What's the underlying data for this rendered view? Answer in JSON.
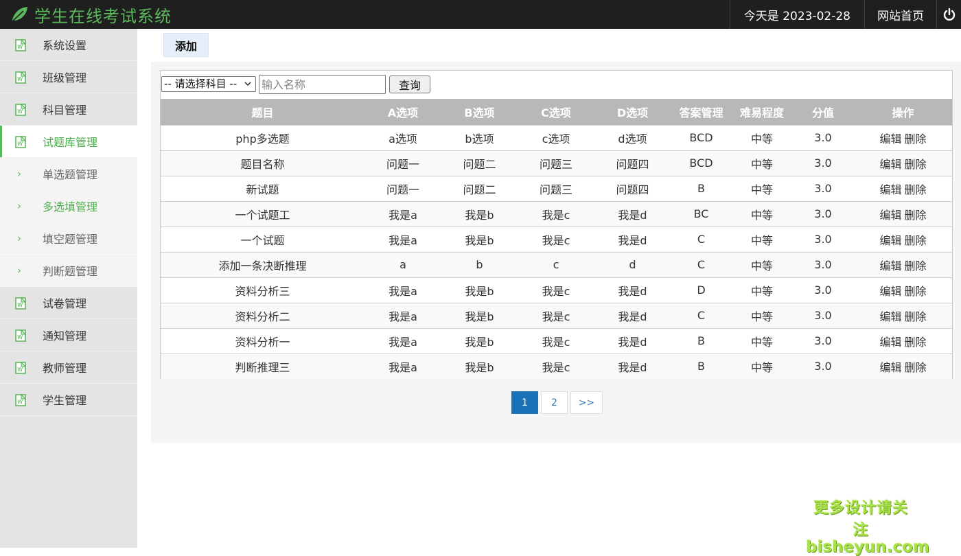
{
  "header": {
    "app_title": "学生在线考试系统",
    "date_text": "今天是 2023-02-28",
    "home_link": "网站首页",
    "brand_color": "#5cb85c"
  },
  "sidebar": {
    "items": [
      {
        "label": "系统设置",
        "icon": "document-icon"
      },
      {
        "label": "班级管理",
        "icon": "document-icon"
      },
      {
        "label": "科目管理",
        "icon": "document-icon"
      },
      {
        "label": "试题库管理",
        "icon": "document-icon",
        "active": true
      },
      {
        "label": "单选题管理",
        "icon": "chevron-right-icon",
        "sub": true
      },
      {
        "label": "多选填管理",
        "icon": "chevron-right-icon",
        "sub": true,
        "current": true
      },
      {
        "label": "填空题管理",
        "icon": "chevron-right-icon",
        "sub": true
      },
      {
        "label": "判断题管理",
        "icon": "chevron-right-icon",
        "sub": true
      },
      {
        "label": "试卷管理",
        "icon": "document-icon"
      },
      {
        "label": "通知管理",
        "icon": "document-icon"
      },
      {
        "label": "教师管理",
        "icon": "document-icon"
      },
      {
        "label": "学生管理",
        "icon": "document-icon"
      }
    ]
  },
  "toolbar": {
    "add_label": "添加"
  },
  "filter": {
    "subject_selected": "-- 请选择科目 --",
    "name_placeholder": "输入名称",
    "query_label": "查询"
  },
  "table": {
    "columns": [
      "题目",
      "A选项",
      "B选项",
      "C选项",
      "D选项",
      "答案管理",
      "难易程度",
      "分值",
      "操作"
    ],
    "edit_label": "编辑",
    "delete_label": "删除",
    "rows": [
      [
        "php多选题",
        "a选项",
        "b选项",
        "c选项",
        "d选项",
        "BCD",
        "中等",
        "3.0"
      ],
      [
        "题目名称",
        "问题一",
        "问题二",
        "问题三",
        "问题四",
        "BCD",
        "中等",
        "3.0"
      ],
      [
        "新试题",
        "问题一",
        "问题二",
        "问题三",
        "问题四",
        "B",
        "中等",
        "3.0"
      ],
      [
        "一个试题工",
        "我是a",
        "我是b",
        "我是c",
        "我是d",
        "BC",
        "中等",
        "3.0"
      ],
      [
        "一个试题",
        "我是a",
        "我是b",
        "我是c",
        "我是d",
        "C",
        "中等",
        "3.0"
      ],
      [
        "添加一条决断推理",
        "a",
        "b",
        "c",
        "d",
        "C",
        "中等",
        "3.0"
      ],
      [
        "资料分析三",
        "我是a",
        "我是b",
        "我是c",
        "我是d",
        "D",
        "中等",
        "3.0"
      ],
      [
        "资料分析二",
        "我是a",
        "我是b",
        "我是c",
        "我是d",
        "C",
        "中等",
        "3.0"
      ],
      [
        "资料分析一",
        "我是a",
        "我是b",
        "我是c",
        "我是d",
        "B",
        "中等",
        "3.0"
      ],
      [
        "判断推理三",
        "我是a",
        "我是b",
        "我是c",
        "我是d",
        "B",
        "中等",
        "3.0"
      ]
    ]
  },
  "pagination": {
    "pages": [
      "1",
      "2"
    ],
    "current": "1",
    "next_label": ">>"
  },
  "watermark": {
    "line1": "更多设计请关注",
    "line2": "bisheyun.com"
  }
}
